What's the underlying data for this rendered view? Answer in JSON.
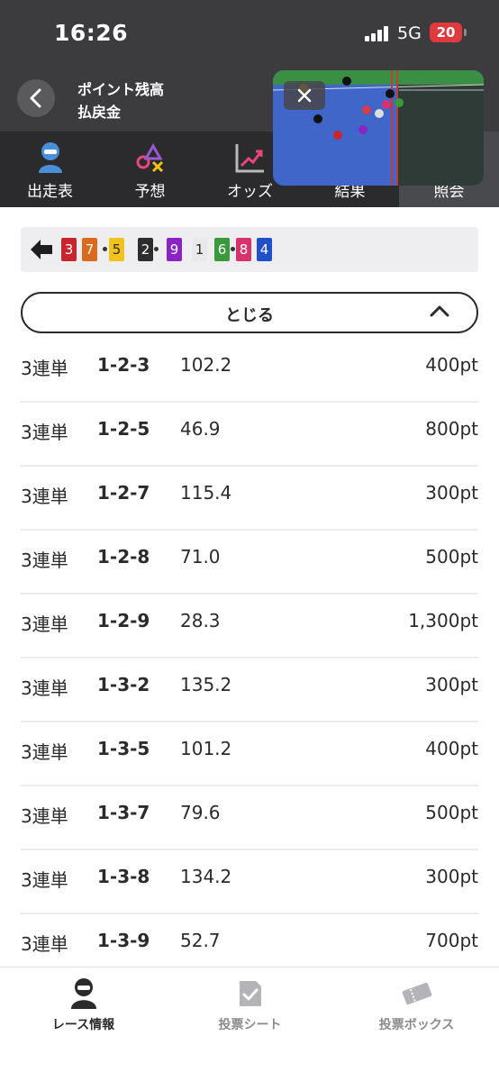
{
  "status_bar": {
    "time": "16:26",
    "network": "5G",
    "battery": "20"
  },
  "header": {
    "line1": "ポイント残高",
    "line2": "払戻金"
  },
  "tabs": [
    {
      "label": "出走表",
      "icon": "racer-icon"
    },
    {
      "label": "予想",
      "icon": "shapes-icon"
    },
    {
      "label": "オッズ",
      "icon": "trend-chart-icon"
    },
    {
      "label": "結果",
      "icon": "results-icon"
    },
    {
      "label": "照会",
      "icon": "inquiry-icon",
      "active": true
    }
  ],
  "result": {
    "chips": [
      {
        "number": "3",
        "color": "#c8262c"
      },
      {
        "number": "7",
        "color": "#d96a1e"
      },
      {
        "number": "5",
        "color": "#f2c31a"
      },
      {
        "number": "2",
        "color": "#2d2d2d"
      },
      {
        "number": "9",
        "color": "#8a23c4"
      },
      {
        "number": "1",
        "color": "#e9e9ea"
      },
      {
        "number": "6",
        "color": "#3a9a3b"
      },
      {
        "number": "8",
        "color": "#d6336c"
      },
      {
        "number": "4",
        "color": "#1f4fc9"
      }
    ]
  },
  "toggle": {
    "label": "とじる"
  },
  "bets": [
    {
      "type": "3連単",
      "combo": "1-2-3",
      "odds": "102.2",
      "points": "400pt"
    },
    {
      "type": "3連単",
      "combo": "1-2-5",
      "odds": "46.9",
      "points": "800pt"
    },
    {
      "type": "3連単",
      "combo": "1-2-7",
      "odds": "115.4",
      "points": "300pt"
    },
    {
      "type": "3連単",
      "combo": "1-2-8",
      "odds": "71.0",
      "points": "500pt"
    },
    {
      "type": "3連単",
      "combo": "1-2-9",
      "odds": "28.3",
      "points": "1,300pt"
    },
    {
      "type": "3連単",
      "combo": "1-3-2",
      "odds": "135.2",
      "points": "300pt"
    },
    {
      "type": "3連単",
      "combo": "1-3-5",
      "odds": "101.2",
      "points": "400pt"
    },
    {
      "type": "3連単",
      "combo": "1-3-7",
      "odds": "79.6",
      "points": "500pt"
    },
    {
      "type": "3連単",
      "combo": "1-3-8",
      "odds": "134.2",
      "points": "300pt"
    },
    {
      "type": "3連単",
      "combo": "1-3-9",
      "odds": "52.7",
      "points": "700pt"
    }
  ],
  "bottom_nav": [
    {
      "label": "レース情報",
      "icon": "racer-icon",
      "active": true
    },
    {
      "label": "投票シート",
      "icon": "checkmark-sheet-icon",
      "active": false
    },
    {
      "label": "投票ボックス",
      "icon": "ticket-icon",
      "active": false
    }
  ]
}
